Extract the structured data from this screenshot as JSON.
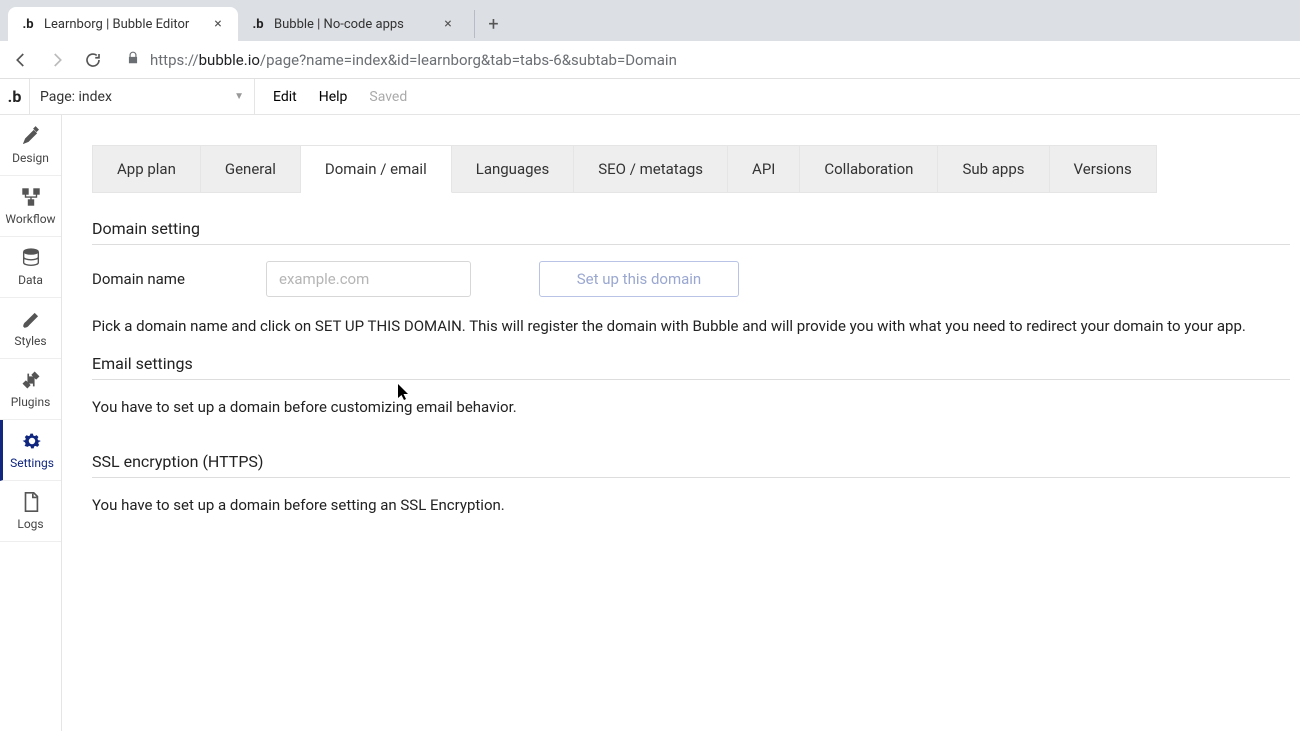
{
  "browser": {
    "tabs": [
      {
        "title": "Learnborg | Bubble Editor",
        "active": true
      },
      {
        "title": "Bubble | No-code apps",
        "active": false
      }
    ],
    "url_proto": "https://",
    "url_host": "bubble.io",
    "url_path": "/page?name=index&id=learnborg&tab=tabs-6&subtab=Domain"
  },
  "appbar": {
    "page_label": "Page: index",
    "menu": {
      "edit": "Edit",
      "help": "Help",
      "saved": "Saved"
    }
  },
  "sidebar": {
    "items": [
      {
        "label": "Design"
      },
      {
        "label": "Workflow"
      },
      {
        "label": "Data"
      },
      {
        "label": "Styles"
      },
      {
        "label": "Plugins"
      },
      {
        "label": "Settings"
      },
      {
        "label": "Logs"
      }
    ]
  },
  "settings_tabs": [
    "App plan",
    "General",
    "Domain / email",
    "Languages",
    "SEO / metatags",
    "API",
    "Collaboration",
    "Sub apps",
    "Versions"
  ],
  "domain": {
    "section_title": "Domain setting",
    "name_label": "Domain name",
    "name_placeholder": "example.com",
    "name_value": "",
    "setup_button": "Set up this domain",
    "help": "Pick a domain name and click on SET UP THIS DOMAIN. This will register the domain with Bubble and will provide you with what you need to redirect your domain to your app."
  },
  "email": {
    "section_title": "Email settings",
    "help": "You have to set up a domain before customizing email behavior."
  },
  "ssl": {
    "section_title": "SSL encryption (HTTPS)",
    "help": "You have to set up a domain before setting an SSL Encryption."
  }
}
